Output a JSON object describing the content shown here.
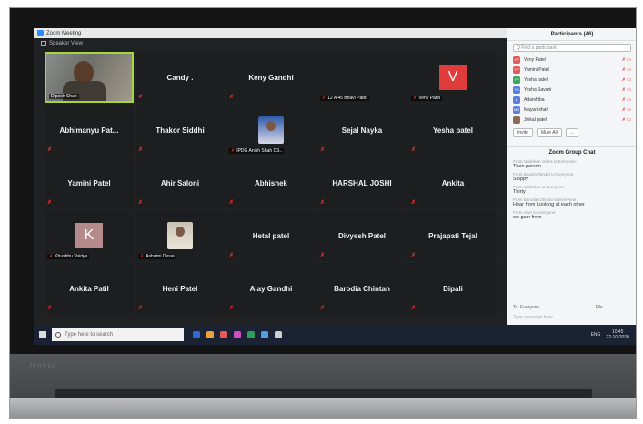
{
  "window": {
    "title": "Zoom Meeting"
  },
  "view": {
    "label": "Speaker View"
  },
  "tiles": [
    {
      "name": "Dipesh Shah",
      "type": "video",
      "active": true
    },
    {
      "name": "Candy .",
      "type": "name"
    },
    {
      "name": "Keny Gandhi",
      "type": "name"
    },
    {
      "name": "12 A 45 Bhavi Patel",
      "type": "caption"
    },
    {
      "name": "Veny Patel",
      "type": "avatar",
      "letter": "V",
      "color": "#e03c3c"
    },
    {
      "name": "Abhimanyu  Pat...",
      "type": "name"
    },
    {
      "name": "Thakor Siddhi",
      "type": "name"
    },
    {
      "name": "IPDG Anish Shah  DS..",
      "type": "photo"
    },
    {
      "name": "Sejal Nayka",
      "type": "name"
    },
    {
      "name": "Yesha patel",
      "type": "name"
    },
    {
      "name": "Yamini Patel",
      "type": "name"
    },
    {
      "name": "Ahir Saloni",
      "type": "name"
    },
    {
      "name": "Abhishek",
      "type": "name"
    },
    {
      "name": "HARSHAL JOSHI",
      "type": "name"
    },
    {
      "name": "Ankita",
      "type": "name"
    },
    {
      "name": "Khushbu Vaidya",
      "type": "avatar",
      "letter": "K",
      "color": "#b58a8a"
    },
    {
      "name": "Ashwini Desai",
      "type": "photo-light"
    },
    {
      "name": "Hetal patel",
      "type": "name"
    },
    {
      "name": "Divyesh Patel",
      "type": "name"
    },
    {
      "name": "Prajapati Tejal",
      "type": "name"
    },
    {
      "name": "Ankita Patil",
      "type": "name"
    },
    {
      "name": "Heni Patel",
      "type": "name"
    },
    {
      "name": "Alay Gandhi",
      "type": "name"
    },
    {
      "name": "Barodia Chintan",
      "type": "name"
    },
    {
      "name": "Dipali",
      "type": "name"
    }
  ],
  "participants": {
    "title": "Participants (46)",
    "search_placeholder": "Q Find a participant",
    "list": [
      {
        "initials": "VP",
        "name": "Veny Patel",
        "color": "#e05a5a"
      },
      {
        "initials": "YP",
        "name": "Yamini Patel",
        "color": "#e05a5a"
      },
      {
        "initials": "YP",
        "name": "Yesha patel",
        "color": "#3aa55d"
      },
      {
        "initials": "YS",
        "name": "Yesha Savani",
        "color": "#5a7de0"
      },
      {
        "initials": "A",
        "name": "Adarshiba",
        "color": "#5a7de0"
      },
      {
        "initials": "MS",
        "name": "Mayuri shah",
        "color": "#5a7de0"
      },
      {
        "initials": "",
        "name": "Jinkal patel",
        "color": "#8a6a5a"
      }
    ],
    "invite_label": "Invite",
    "mute_all_label": "Mute All",
    "more_label": "..."
  },
  "chat": {
    "title": "Zoom Group Chat",
    "messages": [
      {
        "from": "From Vaidehee Vohra to Everyone:",
        "text": "Then person"
      },
      {
        "from": "From Bhavini Tandel to Everyone:",
        "text": "Sloppy"
      },
      {
        "from": "From Vaidehee to Everyone:",
        "text": "Thirty"
      },
      {
        "from": "From Barodia Chintan to Everyone:",
        "text": "Hear from Looking at each other"
      },
      {
        "from": "From Veer to Everyone:",
        "text": "we gain from"
      }
    ],
    "to_label": "To:  Everyone",
    "file_label": "File",
    "input_placeholder": "Type message here..."
  },
  "taskbar": {
    "search_placeholder": "Type here to search",
    "apps": [
      "#2d6ad8",
      "#e8a33d",
      "#e85a5a",
      "#d04fc0",
      "#2e9e5a",
      "#4fa0e0",
      "#d0d0d0"
    ],
    "lang": "ENG",
    "time": "10:45",
    "date": "22-10-2020"
  },
  "laptop": {
    "brand": "lenovo"
  }
}
